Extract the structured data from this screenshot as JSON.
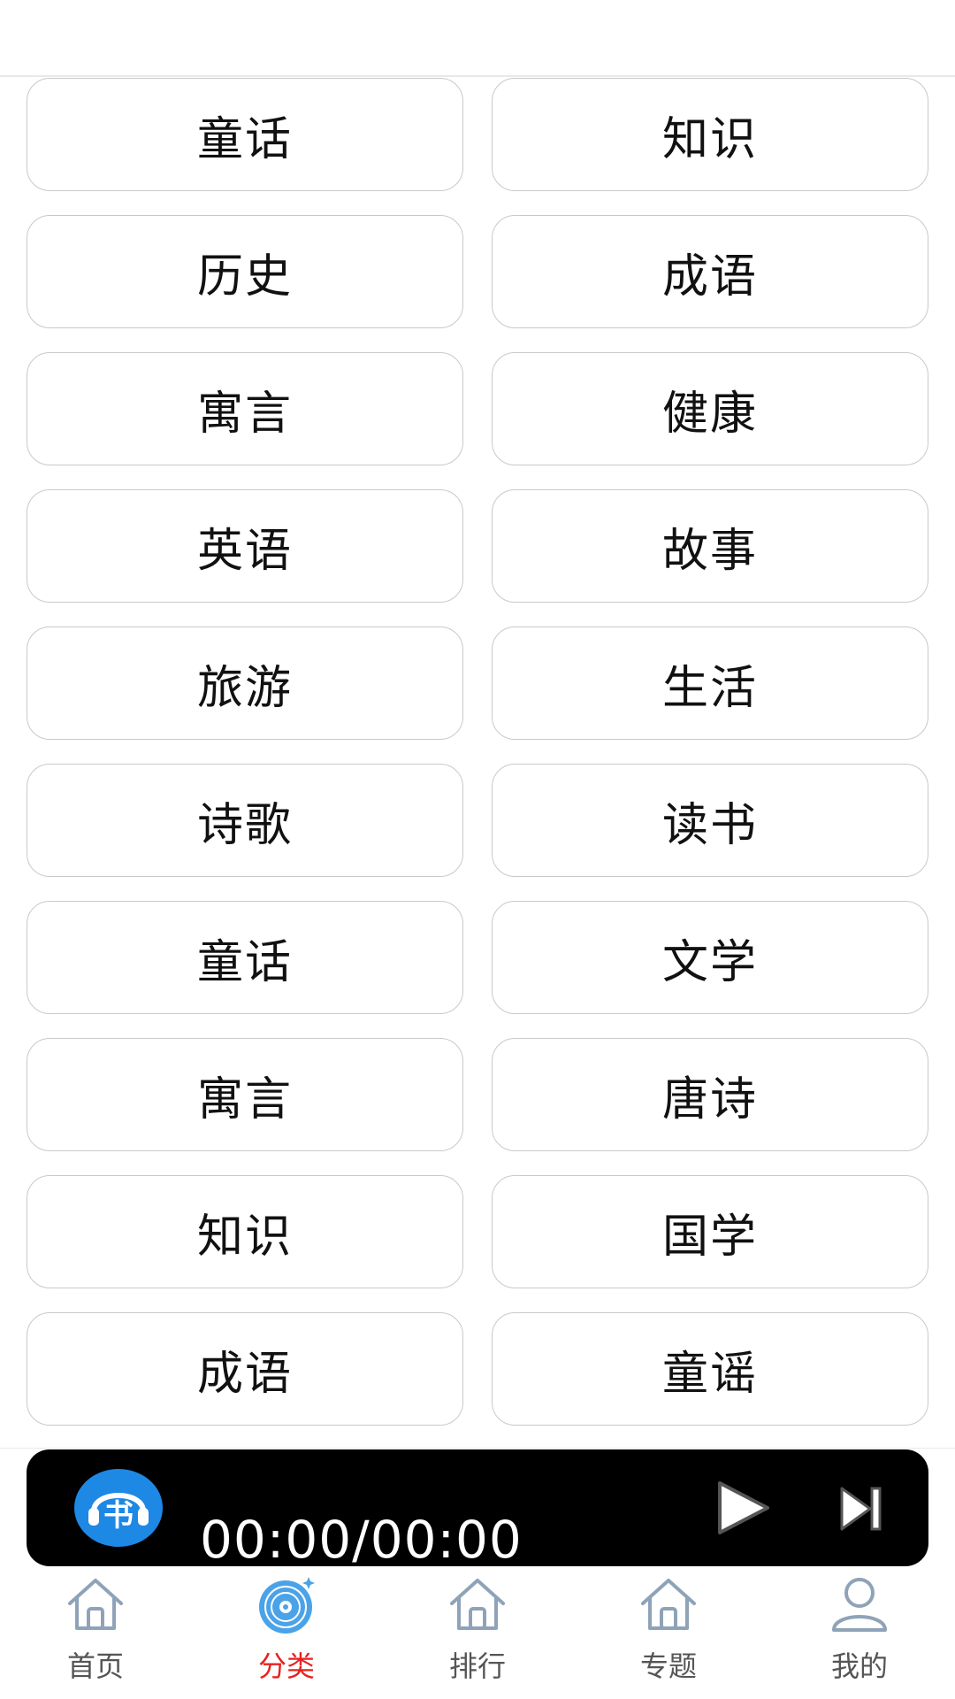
{
  "categories": [
    "童话",
    "知识",
    "历史",
    "成语",
    "寓言",
    "健康",
    "英语",
    "故事",
    "旅游",
    "生活",
    "诗歌",
    "读书",
    "童话",
    "文学",
    "寓言",
    "唐诗",
    "知识",
    "国学",
    "成语",
    "童谣"
  ],
  "player": {
    "time": "00:00/00:00",
    "logo_icon": "book-headphones-logo-icon",
    "play_icon": "play-icon",
    "next_icon": "skip-next-icon"
  },
  "tabs": [
    {
      "label": "首页",
      "icon": "home-icon",
      "active": false
    },
    {
      "label": "分类",
      "icon": "disc-icon",
      "active": true
    },
    {
      "label": "排行",
      "icon": "home-icon",
      "active": false
    },
    {
      "label": "专题",
      "icon": "home-icon",
      "active": false
    },
    {
      "label": "我的",
      "icon": "user-icon",
      "active": false
    }
  ],
  "colors": {
    "active_tab": "#e8211f",
    "logo_blue": "#1e88e5",
    "player_bg": "#000000"
  }
}
